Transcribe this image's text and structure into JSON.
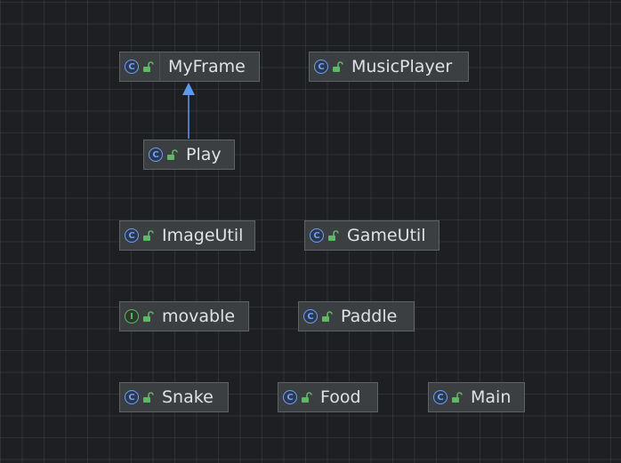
{
  "diagram": {
    "nodes": [
      {
        "id": "myframe",
        "label": "MyFrame",
        "kind": "class",
        "kind_glyph": "C",
        "access_icon": "unlocked-icon"
      },
      {
        "id": "musicplayer",
        "label": "MusicPlayer",
        "kind": "class",
        "kind_glyph": "C",
        "access_icon": "unlocked-icon"
      },
      {
        "id": "play",
        "label": "Play",
        "kind": "class",
        "kind_glyph": "C",
        "access_icon": "unlocked-icon"
      },
      {
        "id": "imageutil",
        "label": "ImageUtil",
        "kind": "class",
        "kind_glyph": "C",
        "access_icon": "unlocked-icon"
      },
      {
        "id": "gameutil",
        "label": "GameUtil",
        "kind": "class",
        "kind_glyph": "C",
        "access_icon": "unlocked-icon"
      },
      {
        "id": "movable",
        "label": "movable",
        "kind": "interface",
        "kind_glyph": "I",
        "access_icon": "unlocked-icon"
      },
      {
        "id": "paddle",
        "label": "Paddle",
        "kind": "class",
        "kind_glyph": "C",
        "access_icon": "unlocked-icon"
      },
      {
        "id": "snake",
        "label": "Snake",
        "kind": "class",
        "kind_glyph": "C",
        "access_icon": "unlocked-icon"
      },
      {
        "id": "food",
        "label": "Food",
        "kind": "class",
        "kind_glyph": "C",
        "access_icon": "unlocked-icon"
      },
      {
        "id": "main",
        "label": "Main",
        "kind": "class",
        "kind_glyph": "C",
        "access_icon": "unlocked-icon"
      }
    ],
    "edges": [
      {
        "from": "play",
        "to": "myframe",
        "type": "extends"
      }
    ],
    "colors": {
      "background": "#1e1f22",
      "node_fill": "#3c3f41",
      "node_border": "#5f6266",
      "class_icon": "#6fa0f6",
      "interface_icon": "#5fb865",
      "lock_icon": "#5fb865",
      "edge": "#5d9cec",
      "label": "#dfe1e5"
    }
  }
}
